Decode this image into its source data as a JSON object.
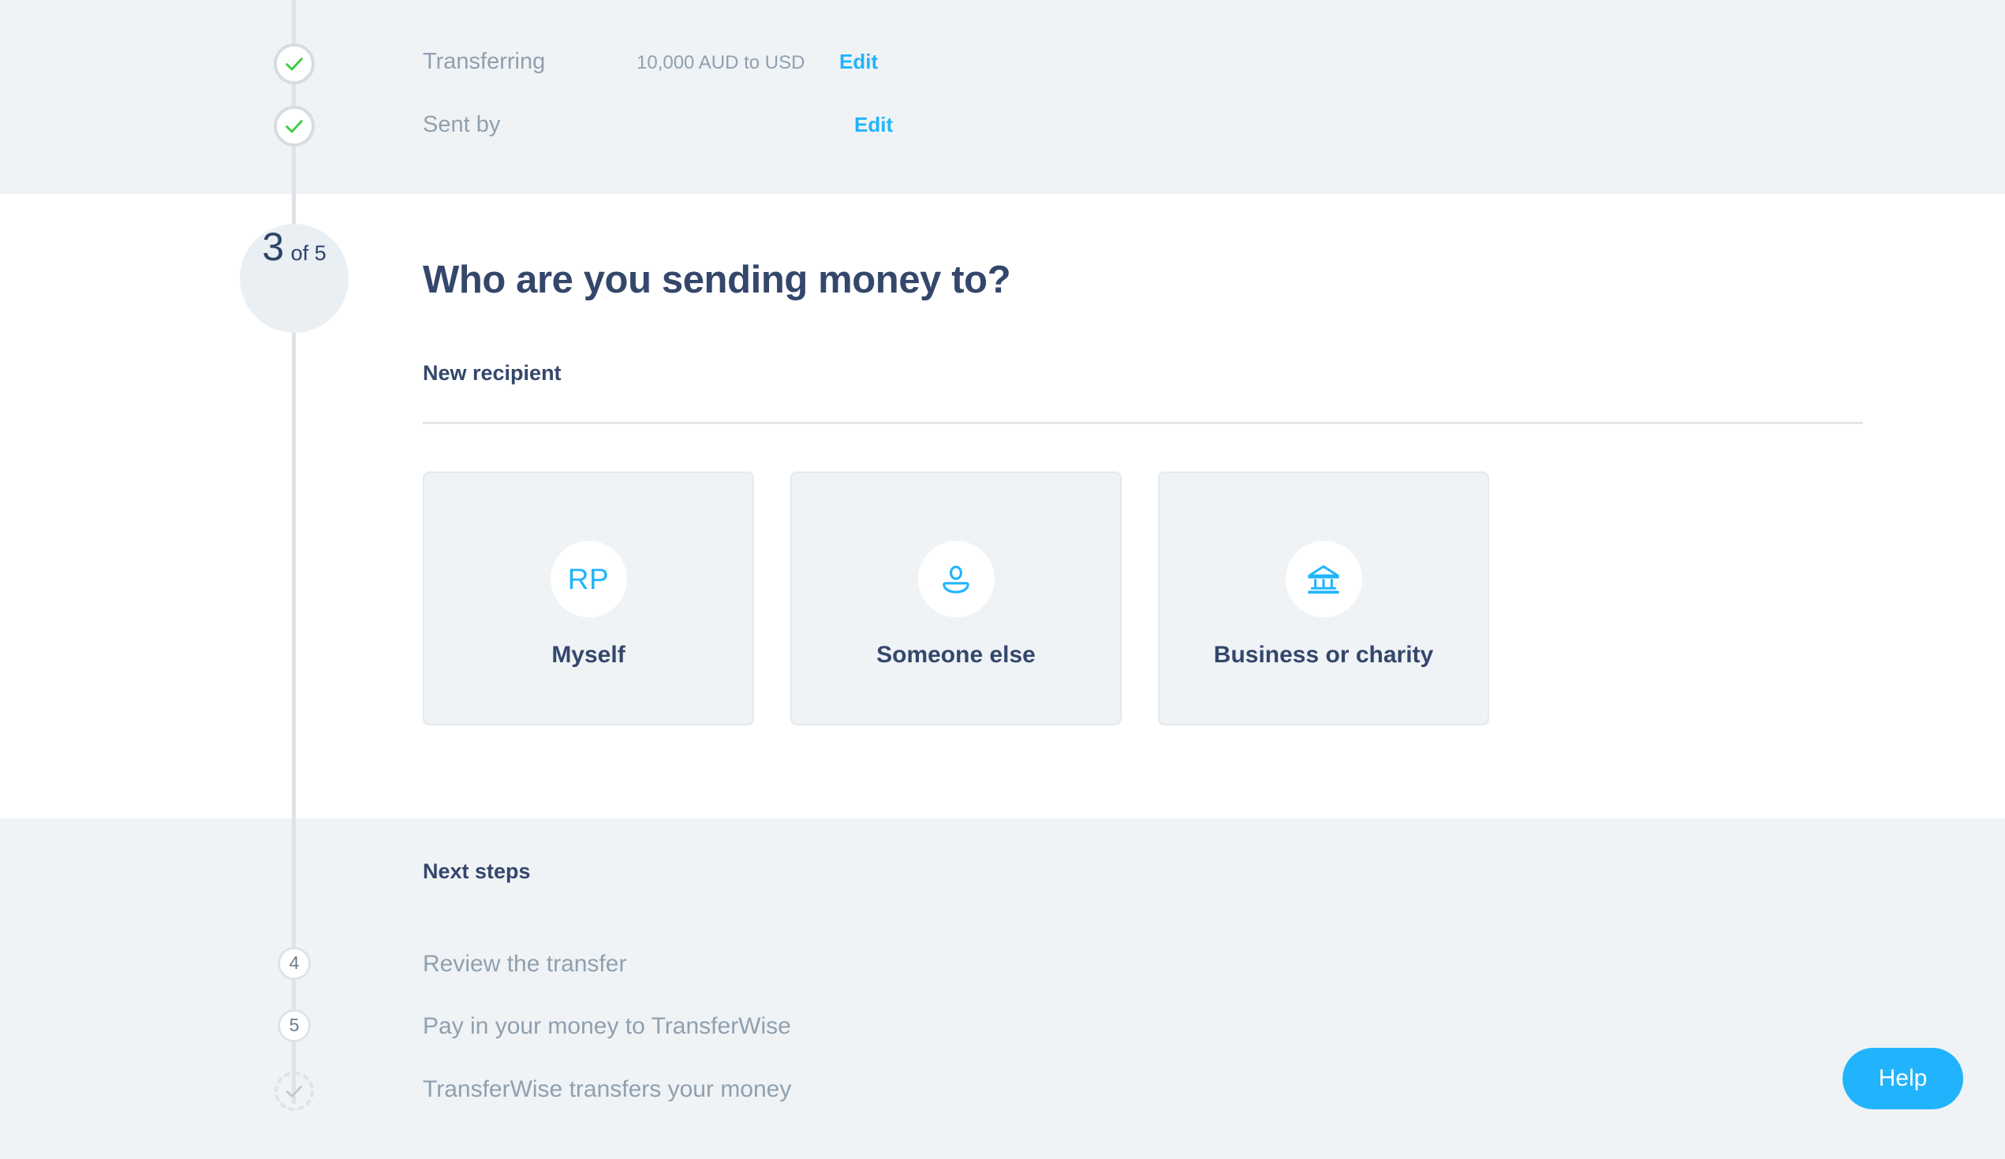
{
  "colors": {
    "accent": "#21b4fd",
    "heading": "#34476b",
    "muted": "#8fa0b0",
    "band": "#f0f3f5",
    "card_bg": "#eff3f6",
    "rail": "#dfe3e8",
    "check_green": "#3ecb3e"
  },
  "summary": {
    "rows": [
      {
        "label": "Transferring",
        "value": "10,000 AUD to USD",
        "edit_label": "Edit"
      },
      {
        "label": "Sent by",
        "value": "",
        "edit_label": "Edit"
      }
    ]
  },
  "current_step": {
    "number": "3",
    "of_text": "of 5"
  },
  "main": {
    "heading": "Who are you sending money to?",
    "subheading": "New recipient",
    "options": [
      {
        "label": "Myself",
        "icon": "avatar-initials-icon",
        "initials": "RP"
      },
      {
        "label": "Someone else",
        "icon": "person-icon",
        "initials": ""
      },
      {
        "label": "Business or charity",
        "icon": "bank-icon",
        "initials": ""
      }
    ]
  },
  "next_steps": {
    "title": "Next steps",
    "items": [
      {
        "bullet": "4",
        "label": "Review the transfer"
      },
      {
        "bullet": "5",
        "label": "Pay in your money to TransferWise"
      },
      {
        "bullet": "check",
        "label": "TransferWise transfers your money"
      }
    ]
  },
  "help": {
    "label": "Help"
  }
}
